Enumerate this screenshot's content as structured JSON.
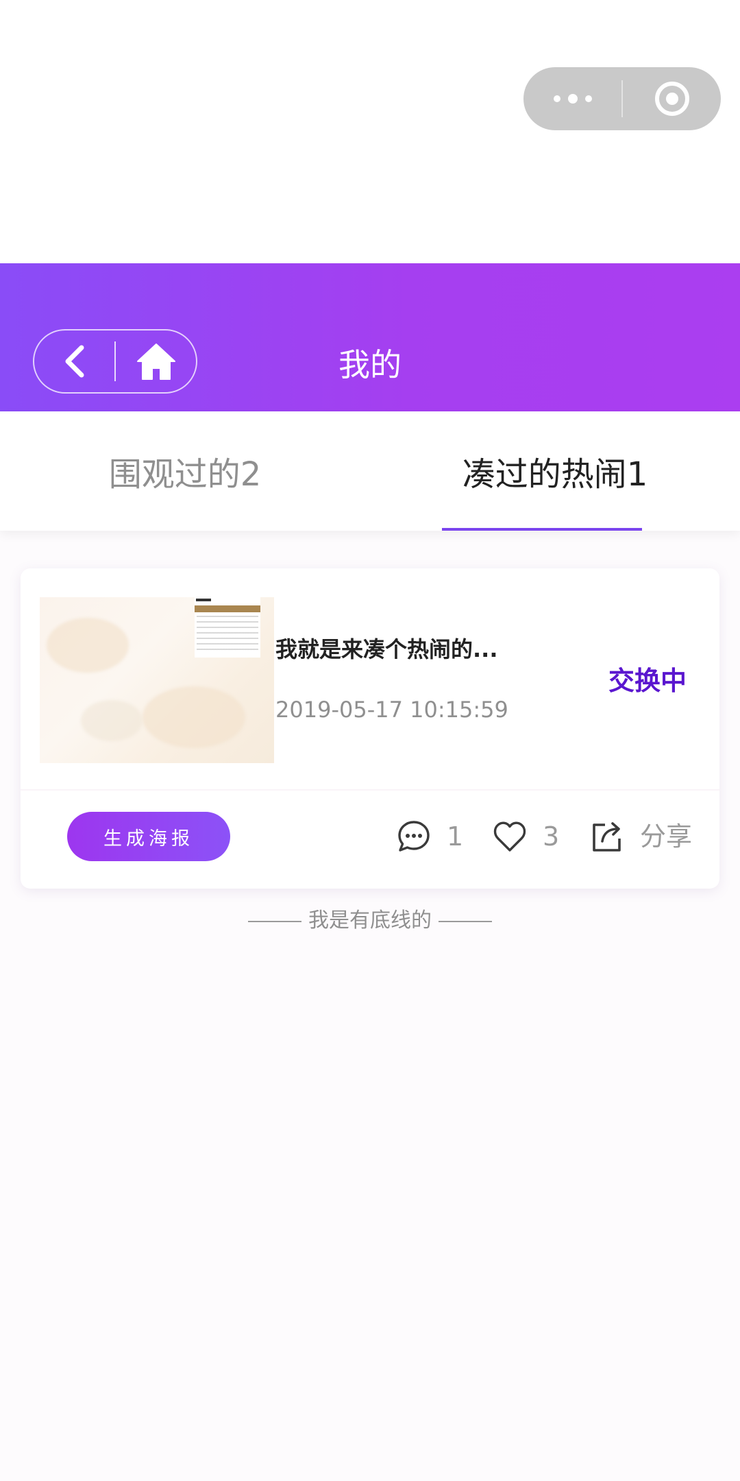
{
  "header": {
    "title": "我的"
  },
  "tabs": [
    {
      "label": "围观过的2",
      "active": false
    },
    {
      "label": "凑过的热闹1",
      "active": true
    }
  ],
  "card": {
    "title": "我就是来凑个热闹的...",
    "time": "2019-05-17 10:15:59",
    "status": "交换中",
    "poster_button": "生成海报",
    "comments": "1",
    "likes": "3",
    "share_label": "分享"
  },
  "footer": {
    "text": "我是有底线的"
  },
  "colors": {
    "header_gradient_start": "#8a4cf7",
    "header_gradient_end": "#ab3ef0",
    "status_color": "#5a16cf",
    "tab_underline": "#7b45ee"
  },
  "icons": {
    "capsule_more": "more-dots-icon",
    "capsule_close": "target-circle-icon",
    "back": "chevron-left-icon",
    "home": "home-icon",
    "comment": "comment-bubble-icon",
    "like": "heart-icon",
    "share": "share-icon"
  }
}
